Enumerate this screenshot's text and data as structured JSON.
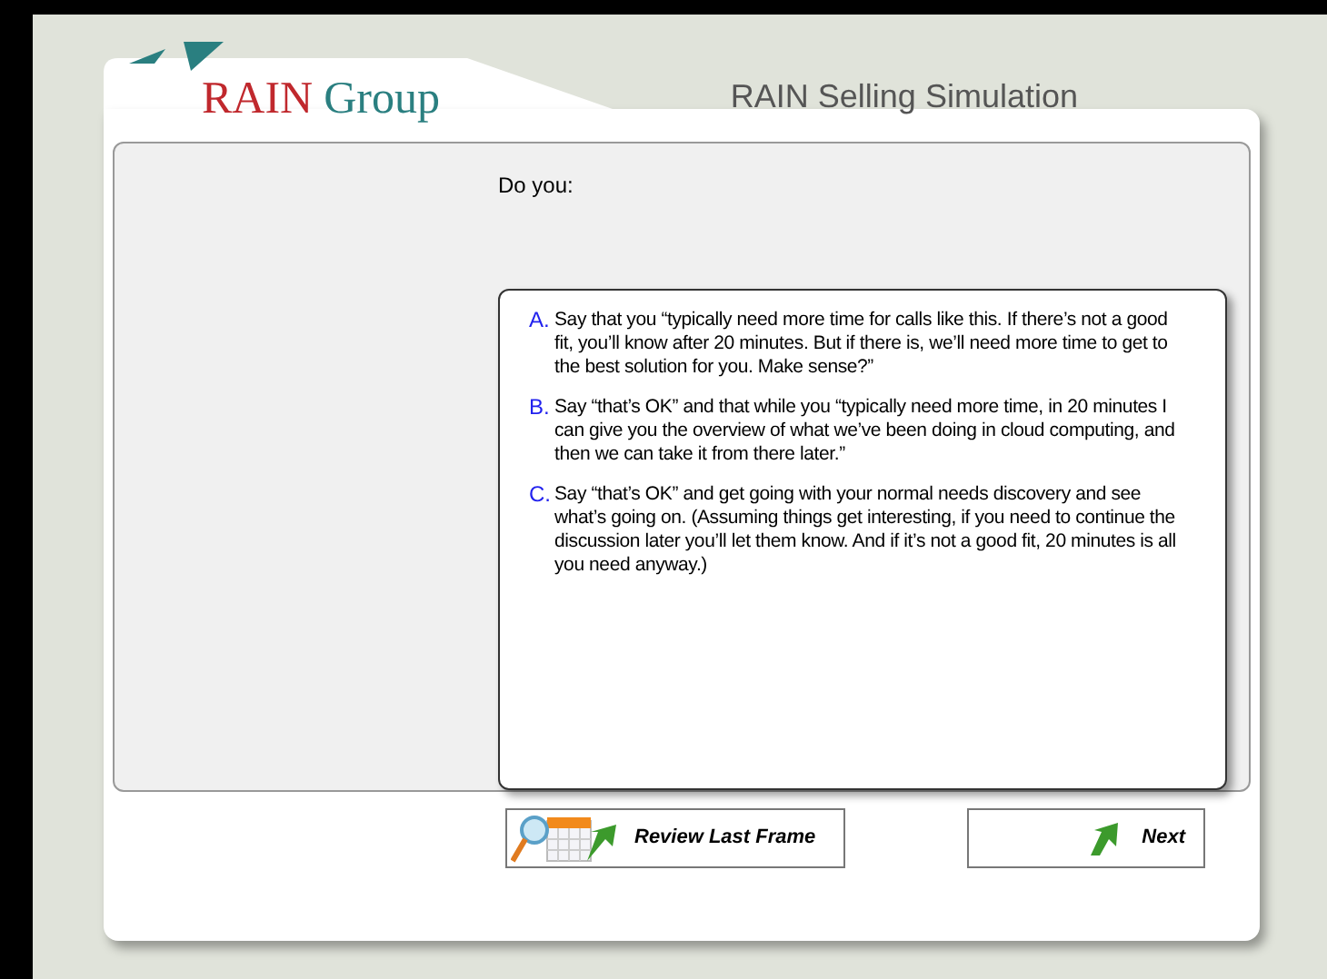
{
  "logo": {
    "word1": "RAIN",
    "word2": "Group"
  },
  "title": "RAIN Selling Simulation",
  "prompt": "Do you:",
  "options": [
    {
      "letter": "A.",
      "text": "Say that you “typically need more time for calls like this. If there’s not a good fit, you’ll know after 20 minutes. But if there is, we’ll need more time to get to the best solution for you. Make sense?”"
    },
    {
      "letter": "B.",
      "text": "Say “that’s OK” and that while you “typically need more time, in 20 minutes I can give you the overview of what we’ve been doing in cloud computing, and then we can take it from there later.”"
    },
    {
      "letter": "C.",
      "text": "Say “that’s OK” and get going with your normal needs discovery and see what’s going on. (Assuming things get interesting, if you need to continue the discussion later you’ll let them know. And if it’s not a good fit, 20 minutes is all you need anyway.)"
    }
  ],
  "buttons": {
    "review": "Review Last Frame",
    "next": "Next"
  }
}
